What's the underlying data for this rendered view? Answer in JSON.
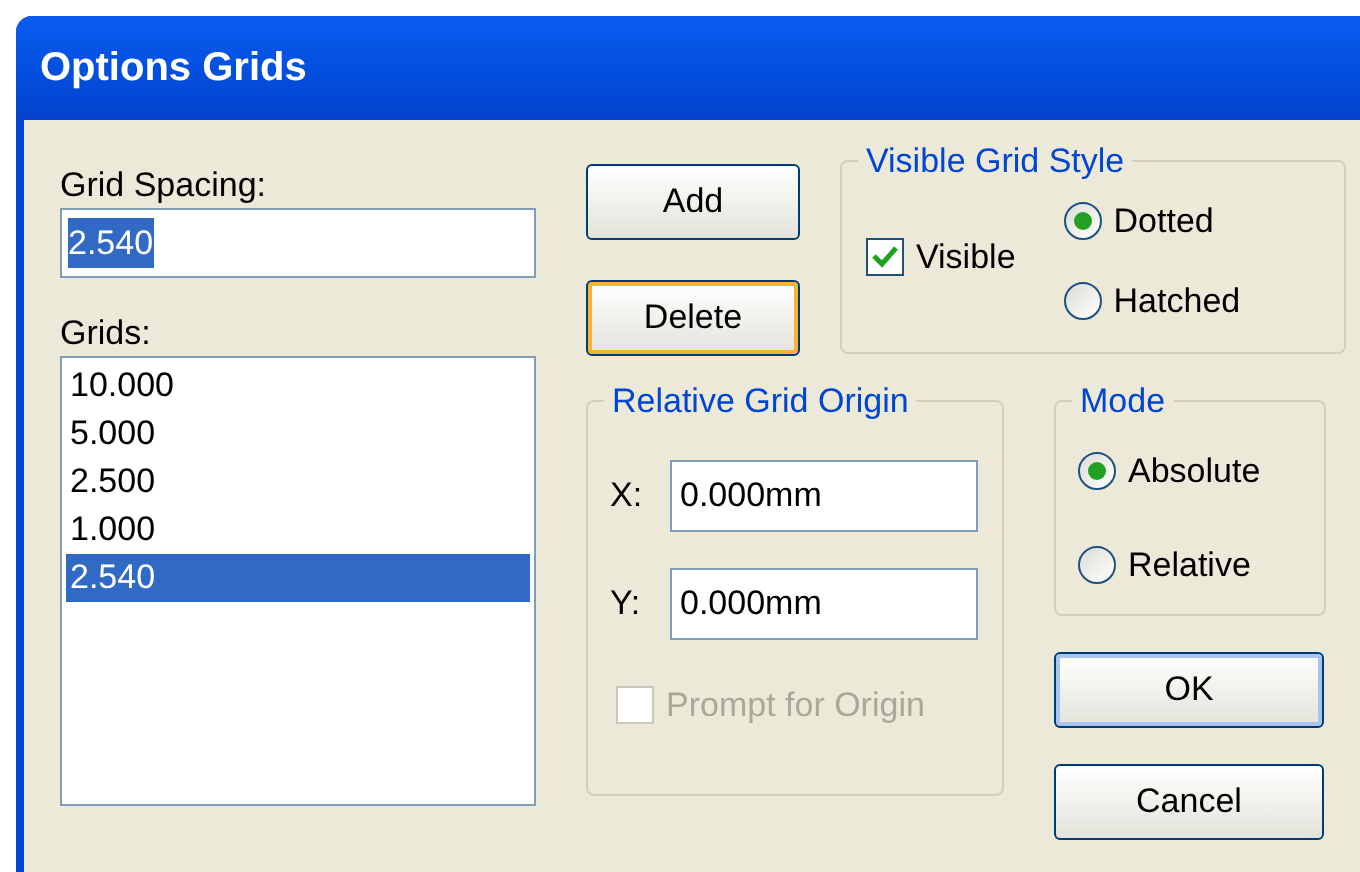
{
  "window": {
    "title": "Options Grids"
  },
  "grid_spacing": {
    "label": "Grid Spacing:",
    "value": "2.540",
    "value_selected": true
  },
  "grids": {
    "label": "Grids:",
    "items": [
      {
        "text": "10.000",
        "selected": false
      },
      {
        "text": "5.000",
        "selected": false
      },
      {
        "text": "2.500",
        "selected": false
      },
      {
        "text": "1.000",
        "selected": false
      },
      {
        "text": "2.540",
        "selected": true
      }
    ]
  },
  "list_buttons": [
    {
      "label": "Add",
      "focused": false
    },
    {
      "label": "Delete",
      "focused": true
    }
  ],
  "visible_grid_style": {
    "title": "Visible Grid Style",
    "visible": {
      "label": "Visible",
      "checked": true
    },
    "options": [
      {
        "label": "Dotted",
        "selected": true
      },
      {
        "label": "Hatched",
        "selected": false
      }
    ]
  },
  "relative_grid_origin": {
    "title": "Relative Grid Origin",
    "fields": [
      {
        "label": "X:",
        "value": "0.000mm"
      },
      {
        "label": "Y:",
        "value": "0.000mm"
      }
    ],
    "prompt": {
      "label": "Prompt for Origin",
      "checked": false,
      "disabled": true
    }
  },
  "mode": {
    "title": "Mode",
    "options": [
      {
        "label": "Absolute",
        "selected": true
      },
      {
        "label": "Relative",
        "selected": false
      }
    ]
  },
  "dialog_buttons": [
    {
      "label": "OK",
      "default": true
    },
    {
      "label": "Cancel",
      "default": false
    }
  ]
}
